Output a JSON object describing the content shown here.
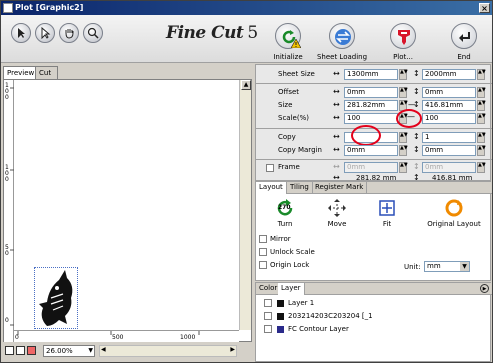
{
  "window": {
    "title": "Plot [Graphic2]",
    "close_glyph": "×"
  },
  "toolbar": {
    "tools": [
      {
        "name": "select-arrow-icon"
      },
      {
        "name": "node-arrow-icon"
      },
      {
        "name": "hand-icon"
      },
      {
        "name": "zoom-icon"
      }
    ],
    "logo_text": "Fine Cut",
    "logo_version": "5",
    "buttons": {
      "initialize": "Initialize",
      "sheet_loading": "Sheet Loading",
      "plot": "Plot...",
      "end": "End"
    }
  },
  "left": {
    "tabs": [
      "Preview",
      "Cut Line"
    ],
    "ruler_v_labels": [
      "100",
      "50",
      "0"
    ],
    "ruler_h_labels": [
      "0",
      "500",
      "1000"
    ],
    "zoom": "26.00%"
  },
  "params": {
    "sheet_size": {
      "label": "Sheet Size",
      "w": "1300mm",
      "h": "2000mm"
    },
    "offset": {
      "label": "Offset",
      "w": "0mm",
      "h": "0mm"
    },
    "size": {
      "label": "Size",
      "w": "281.82mm",
      "h": "416.81mm"
    },
    "scale": {
      "label": "Scale(%)",
      "w": "100",
      "h": "100"
    },
    "copy": {
      "label": "Copy",
      "w": "",
      "h": "1"
    },
    "copy_margin": {
      "label": "Copy Margin",
      "w": "0mm",
      "h": "0mm"
    },
    "frame": {
      "label": "Frame",
      "w": "0mm",
      "h": "0mm"
    },
    "frame_size": {
      "w": "281.82 mm",
      "h": "416.81 mm"
    }
  },
  "layout": {
    "tabs": [
      "Layout",
      "Tiling",
      "Register Mark"
    ],
    "turn_value": "270",
    "buttons": [
      "Turn",
      "Move",
      "Fit",
      "Original Layout"
    ],
    "options": [
      "Mirror",
      "Unlock Scale",
      "Origin Lock"
    ],
    "unit_label": "Unit:",
    "unit_value": "mm"
  },
  "layers": {
    "tabs": [
      "Color",
      "Layer"
    ],
    "items": [
      {
        "name": "Layer 1",
        "color": "#111111"
      },
      {
        "name": "203214203C203204 [_1",
        "color": "#111111"
      },
      {
        "name": "FC Contour Layer",
        "color": "#2a2a8a"
      }
    ]
  },
  "colors": {
    "highlight": "#e3001b",
    "title_bar": "#0a246a"
  }
}
